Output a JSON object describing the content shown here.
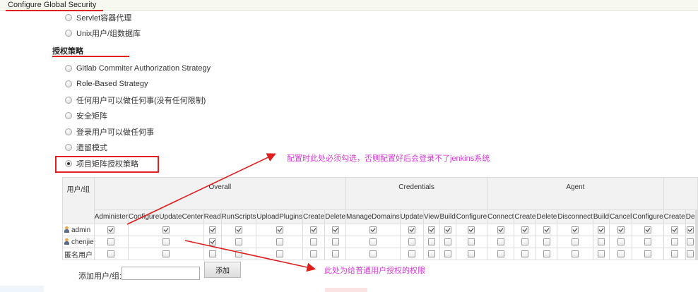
{
  "header": {
    "title": "Configure Global Security"
  },
  "security_realm": {
    "options": [
      {
        "label": "Servlet容器代理",
        "checked": false
      },
      {
        "label": "Unix用户/组数据库",
        "checked": false
      }
    ]
  },
  "authorization": {
    "heading": "授权策略",
    "options": [
      {
        "label": "Gitlab Commiter Authorization Strategy",
        "checked": false
      },
      {
        "label": "Role-Based Strategy",
        "checked": false
      },
      {
        "label": "任何用户可以做任何事(没有任何限制)",
        "checked": false
      },
      {
        "label": "安全矩阵",
        "checked": false
      },
      {
        "label": "登录用户可以做任何事",
        "checked": false
      },
      {
        "label": "遗留模式",
        "checked": false
      },
      {
        "label": "项目矩阵授权策略",
        "checked": true
      }
    ]
  },
  "matrix": {
    "user_header": "用户/组",
    "groups": [
      {
        "name": "Overall",
        "span": 7
      },
      {
        "name": "Credentials",
        "span": 5
      },
      {
        "name": "Agent",
        "span": 7
      },
      {
        "name": "",
        "span": 5
      }
    ],
    "permissions": [
      "Administer",
      "ConfigureUpdateCenter",
      "Read",
      "RunScripts",
      "UploadPlugins",
      "Create",
      "Delete",
      "ManageDomains",
      "Update",
      "View",
      "Build",
      "Configure",
      "Connect",
      "Create",
      "Delete",
      "Disconnect",
      "Build",
      "Cancel",
      "Configure",
      "Create",
      "De"
    ],
    "rows": [
      {
        "user": "admin",
        "icon": "user-icon",
        "checks": [
          1,
          1,
          1,
          1,
          1,
          1,
          1,
          1,
          1,
          1,
          1,
          1,
          1,
          1,
          1,
          1,
          1,
          1,
          1,
          1,
          1
        ]
      },
      {
        "user": "chenjie",
        "icon": "user-icon",
        "checks": [
          0,
          0,
          1,
          0,
          0,
          0,
          0,
          0,
          0,
          0,
          0,
          0,
          0,
          0,
          0,
          0,
          0,
          0,
          0,
          0,
          0
        ]
      },
      {
        "user": "匿名用户",
        "icon": "",
        "checks": [
          0,
          0,
          0,
          0,
          0,
          0,
          0,
          0,
          0,
          0,
          0,
          0,
          0,
          0,
          0,
          0,
          0,
          0,
          0,
          0,
          0
        ]
      }
    ]
  },
  "add_user": {
    "label": "添加用户/组:",
    "value": "",
    "placeholder": "",
    "button": "添加"
  },
  "annotations": {
    "top": "配置时此处必须勾选，否则配置好后会登录不了jenkins系统",
    "bottom": "此处为给普通用户授权的权限"
  },
  "colors": {
    "annotation": "#d43bd4",
    "highlight": "#e0201f"
  }
}
